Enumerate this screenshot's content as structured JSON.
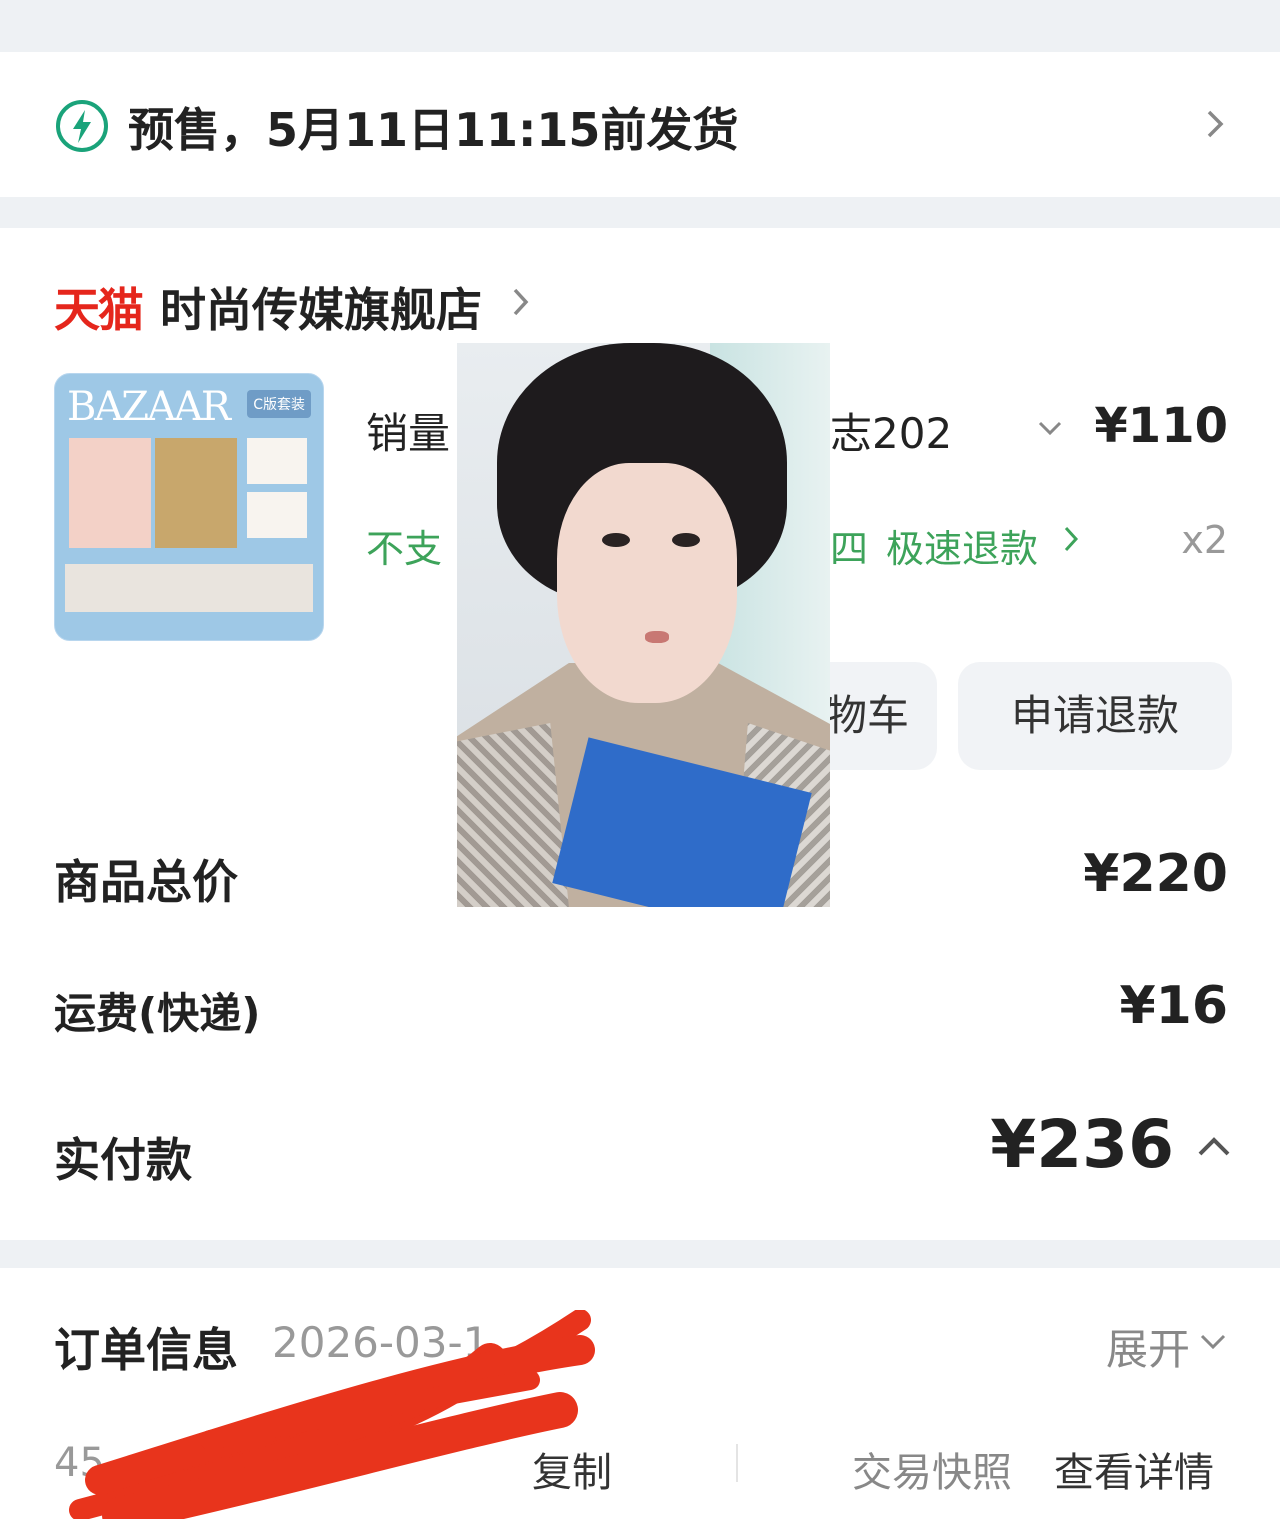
{
  "shipping": {
    "icon": "lightning-icon",
    "text": "预售，5月11日11:15前发货"
  },
  "store": {
    "platform": "天猫",
    "name": "时尚传媒旗舰店"
  },
  "product": {
    "thumb_title": "BAZAAR",
    "thumb_tag": "C版套装",
    "title_left": "销量",
    "title_right": "志202",
    "price": "¥110",
    "qty": "x2",
    "note_left": "不支",
    "note_mid": "四",
    "refund_fast": "极速退款",
    "btn_cart": "物车",
    "btn_refund": "申请退款"
  },
  "summary": {
    "goods_label": "商品总价",
    "goods_value": "¥220",
    "shipping_label": "运费(快递)",
    "shipping_value": "¥16",
    "paid_label": "实付款",
    "paid_value": "¥236"
  },
  "order_info": {
    "label": "订单信息",
    "date": "2026-03-1",
    "expand": "展开",
    "number": "45",
    "copy": "复制",
    "snapshot": "交易快照",
    "detail": "查看详情"
  },
  "colors": {
    "tmall_red": "#e5261c",
    "green": "#3da35a",
    "scribble": "#e8341c"
  }
}
